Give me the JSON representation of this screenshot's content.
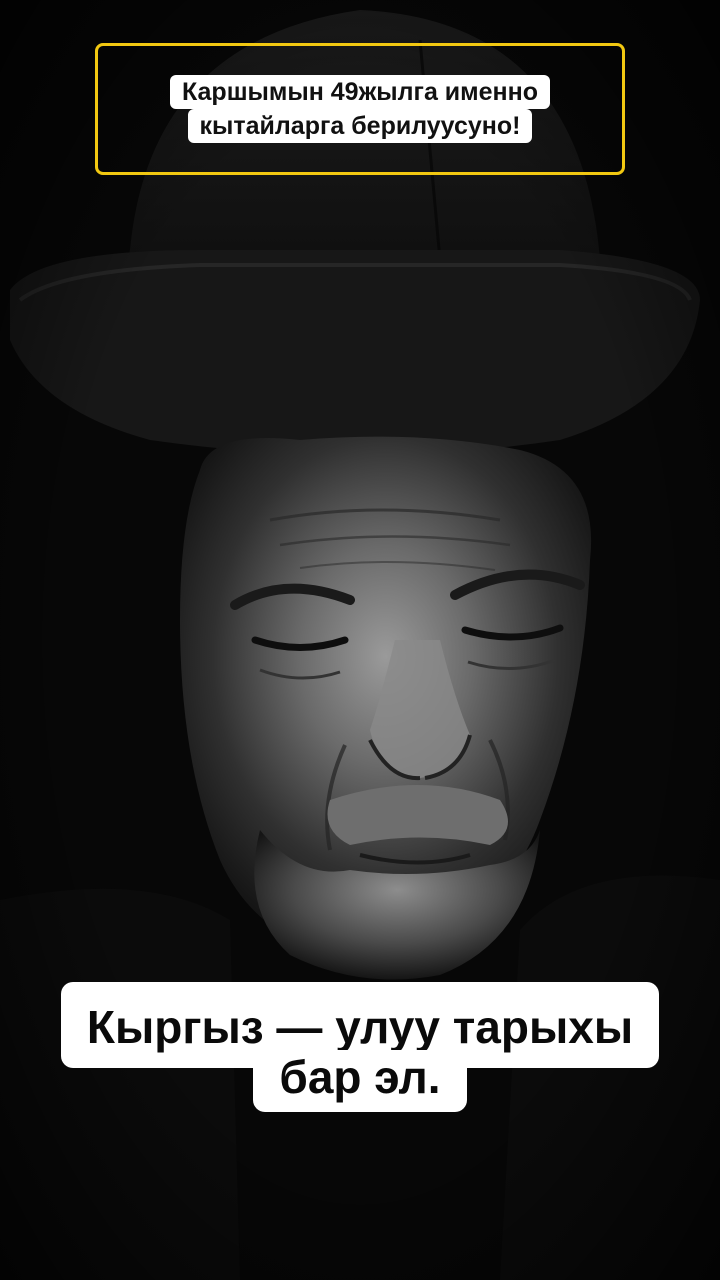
{
  "photo": {
    "description_icon": "portrait-photo",
    "colors": {
      "background": "#080808",
      "skin_highlight": "#8c8c8c",
      "hat": "#1a1a1a"
    }
  },
  "captions": {
    "top": {
      "line1": "Каршымын 49жылга именно",
      "line2": "кытайларга берилуусуно!",
      "border_color": "#f2c811"
    },
    "bottom": {
      "line1": "Кыргыз — улуу тарыхы",
      "line2": "бар эл."
    }
  }
}
